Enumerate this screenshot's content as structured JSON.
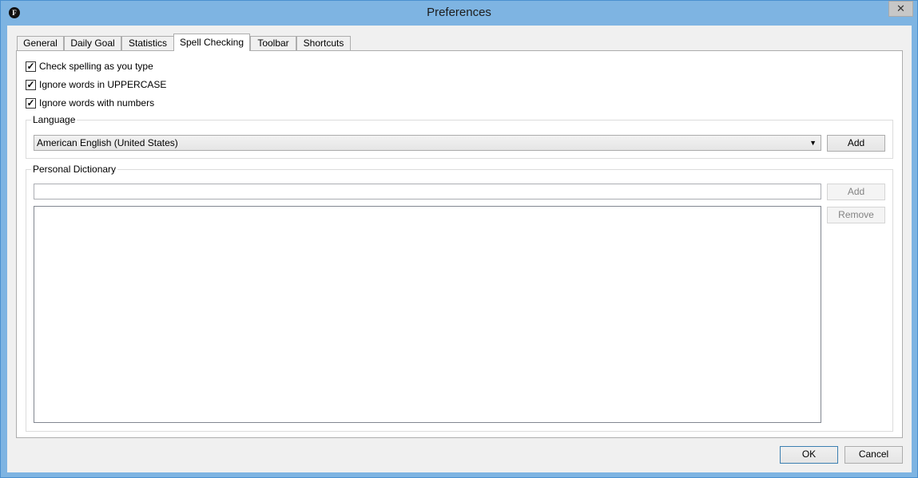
{
  "window": {
    "title": "Preferences",
    "app_icon_letter": "F",
    "close_glyph": "✕"
  },
  "tabs": [
    {
      "label": "General"
    },
    {
      "label": "Daily Goal"
    },
    {
      "label": "Statistics"
    },
    {
      "label": "Spell Checking"
    },
    {
      "label": "Toolbar"
    },
    {
      "label": "Shortcuts"
    }
  ],
  "active_tab": "Spell Checking",
  "options": [
    {
      "label": "Check spelling as you type",
      "checked": true
    },
    {
      "label": "Ignore words in UPPERCASE",
      "checked": true
    },
    {
      "label": "Ignore words with numbers",
      "checked": true
    }
  ],
  "language": {
    "group_label": "Language",
    "selected": "American English (United States)",
    "add_label": "Add"
  },
  "dictionary": {
    "group_label": "Personal Dictionary",
    "word_value": "",
    "add_label": "Add",
    "remove_label": "Remove",
    "words": []
  },
  "footer": {
    "ok_label": "OK",
    "cancel_label": "Cancel"
  },
  "check_glyph": "✓"
}
